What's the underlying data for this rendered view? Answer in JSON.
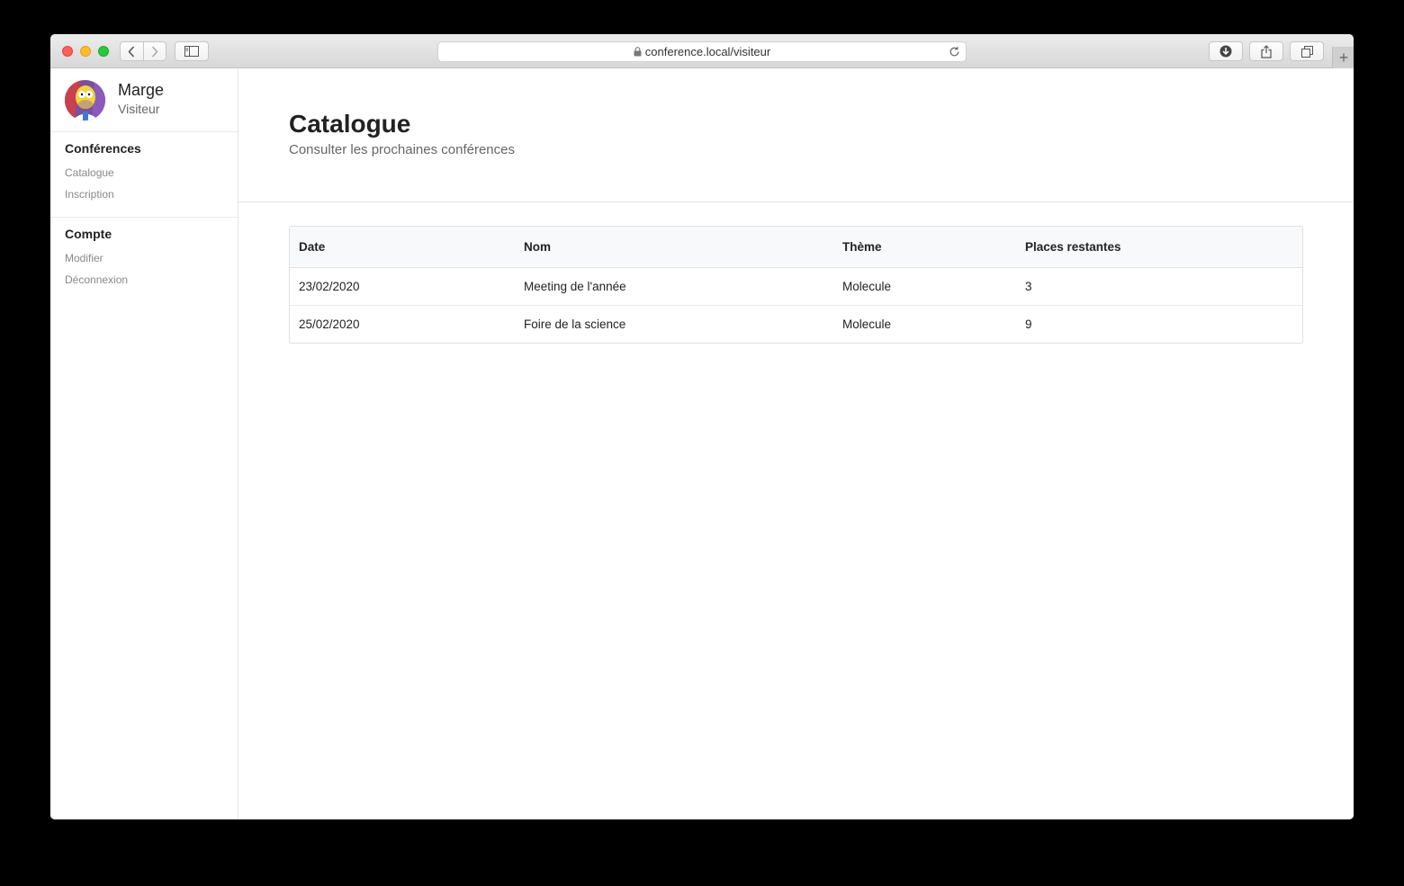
{
  "browser": {
    "url": "conference.local/visiteur"
  },
  "profile": {
    "name": "Marge",
    "role": "Visiteur"
  },
  "sidebar": {
    "sections": [
      {
        "title": "Conférences",
        "links": [
          "Catalogue",
          "Inscription"
        ]
      },
      {
        "title": "Compte",
        "links": [
          "Modifier",
          "Déconnexion"
        ]
      }
    ]
  },
  "page": {
    "title": "Catalogue",
    "subtitle": "Consulter les prochaines conférences"
  },
  "table": {
    "headers": [
      "Date",
      "Nom",
      "Thème",
      "Places restantes"
    ],
    "rows": [
      [
        "23/02/2020",
        "Meeting de l'année",
        "Molecule",
        "3"
      ],
      [
        "25/02/2020",
        "Foire de la science",
        "Molecule",
        "9"
      ]
    ]
  }
}
